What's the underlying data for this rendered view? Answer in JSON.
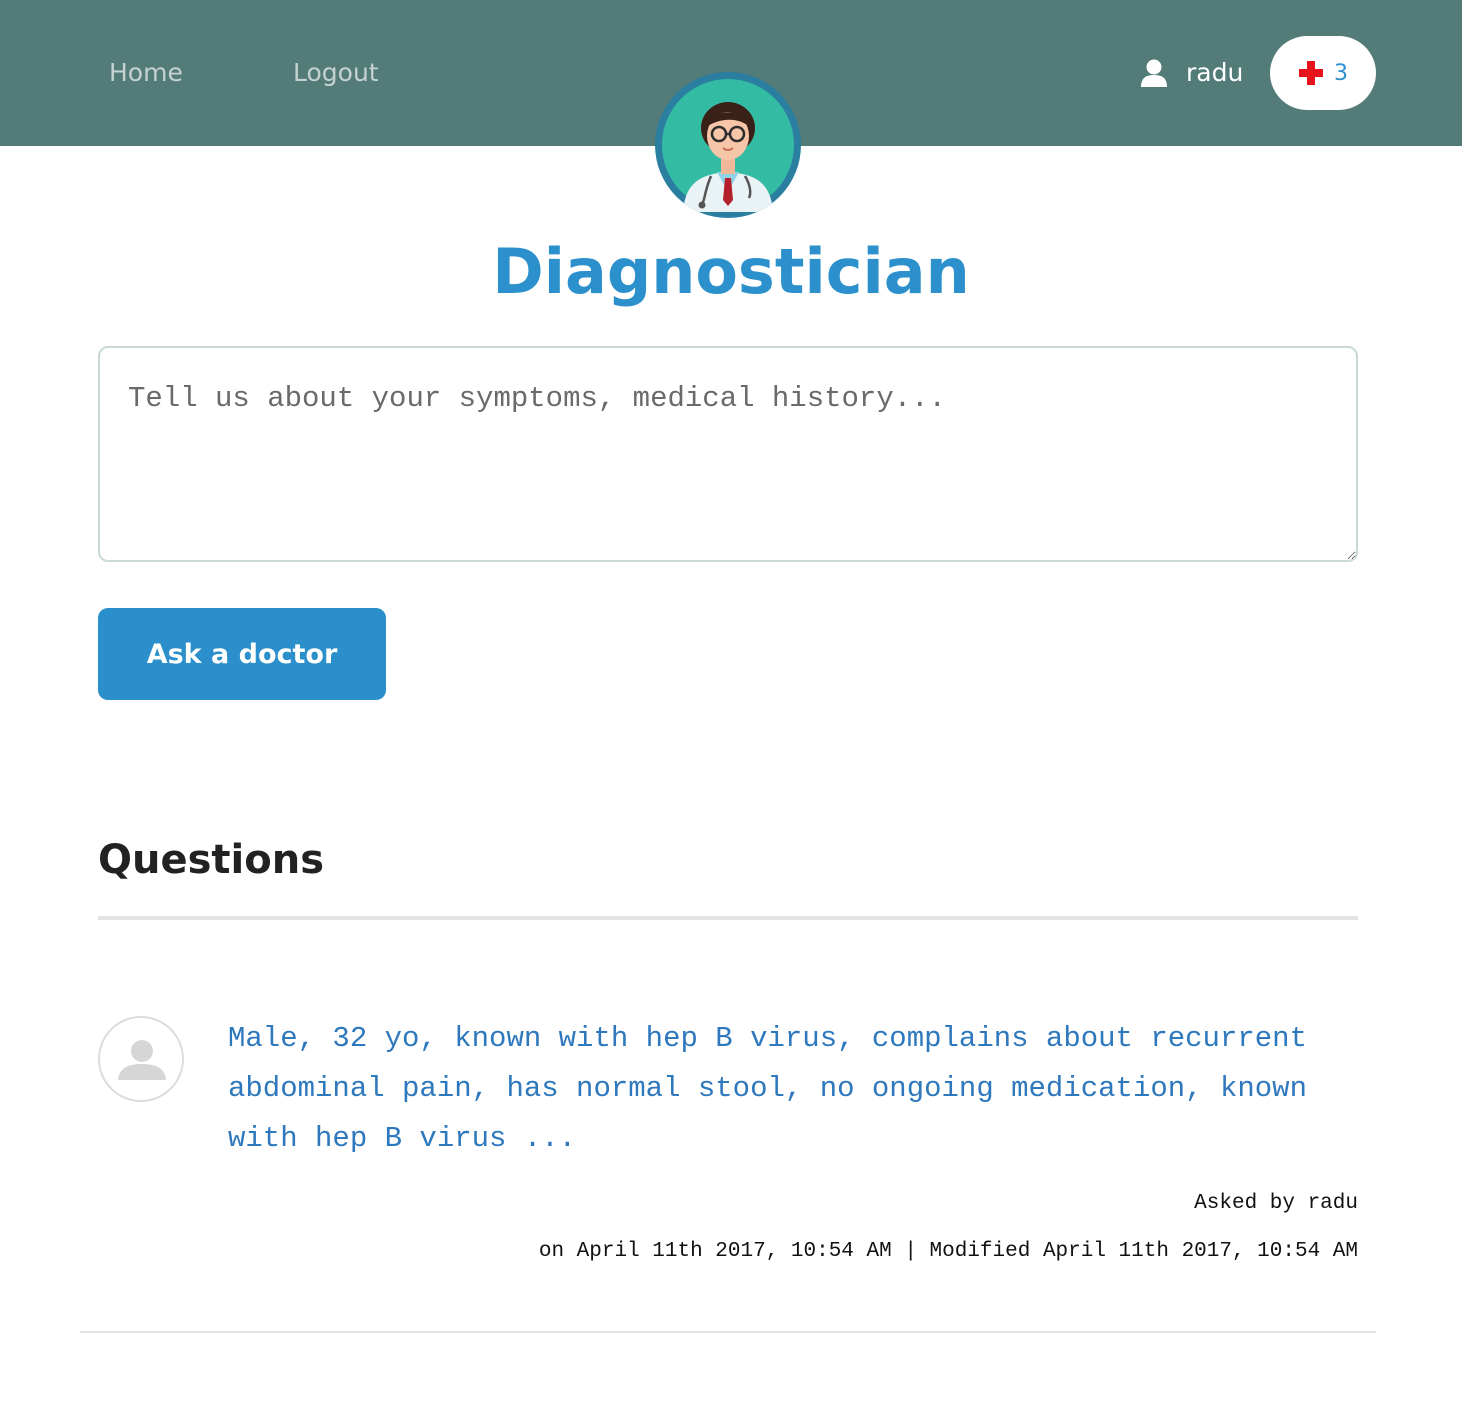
{
  "nav": {
    "home_label": "Home",
    "logout_label": "Logout"
  },
  "user": {
    "name": "radu",
    "icon": "user-icon",
    "points": "3",
    "points_icon": "red-cross-icon"
  },
  "app": {
    "title": "Diagnostician",
    "logo_icon": "doctor-avatar-icon"
  },
  "ask_form": {
    "placeholder": "Tell us about your symptoms, medical history...",
    "value": "",
    "submit_label": "Ask a doctor"
  },
  "questions": {
    "heading": "Questions",
    "items": [
      {
        "text": "Male, 32 yo, known with hep B virus, complains about recurrent abdominal pain, has normal stool, no ongoing medication, known with hep B virus ...",
        "asked_by_prefix": "Asked by ",
        "author": "radu",
        "dates": "on April 11th 2017, 10:54 AM | Modified April 11th 2017, 10:54 AM",
        "avatar_icon": "default-user-avatar-icon"
      }
    ]
  },
  "colors": {
    "header_bg": "#537b78",
    "accent": "#2a8fca",
    "link": "#2e78bd",
    "cross": "#e8141c"
  }
}
